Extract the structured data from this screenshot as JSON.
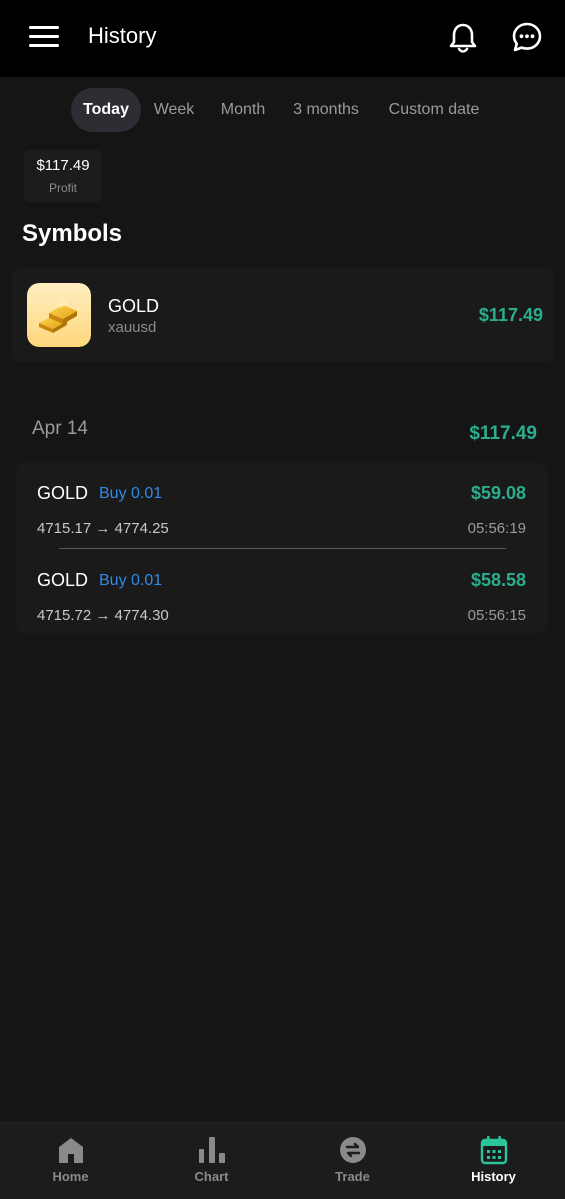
{
  "header": {
    "title": "History",
    "icons": [
      "menu-icon",
      "bell-icon",
      "chat-icon"
    ]
  },
  "tabs": [
    {
      "label": "Today",
      "active": true
    },
    {
      "label": "Week",
      "active": false
    },
    {
      "label": "Month",
      "active": false
    },
    {
      "label": "3 months",
      "active": false
    },
    {
      "label": "Custom date",
      "active": false
    }
  ],
  "summary": {
    "profit_value": "$117.49",
    "profit_label": "Profit"
  },
  "symbols": {
    "title": "Symbols",
    "items": [
      {
        "name": "GOLD",
        "code": "xauusd",
        "amount": "$117.49",
        "icon": "gold-bars-icon"
      }
    ]
  },
  "history": {
    "date": "Apr 14",
    "total": "$117.49",
    "trades": [
      {
        "symbol": "GOLD",
        "side": "Buy 0.01",
        "profit": "$59.08",
        "prices": "4715.17 → 4774.25",
        "time": "05:56:19"
      },
      {
        "symbol": "GOLD",
        "side": "Buy 0.01",
        "profit": "$58.58",
        "prices": "4715.72 → 4774.30",
        "time": "05:56:15"
      }
    ]
  },
  "nav": {
    "items": [
      {
        "label": "Home",
        "icon": "home-icon",
        "active": false
      },
      {
        "label": "Chart",
        "icon": "bar-chart-icon",
        "active": false
      },
      {
        "label": "Trade",
        "icon": "exchange-icon",
        "active": false
      },
      {
        "label": "History",
        "icon": "calendar-icon",
        "active": true
      }
    ]
  },
  "colors": {
    "background": "#151515",
    "card": "#1a1a1a",
    "profit_green": "#2bae8e",
    "buy_blue": "#2f8ae6",
    "nav_active": "#2bc49b"
  }
}
